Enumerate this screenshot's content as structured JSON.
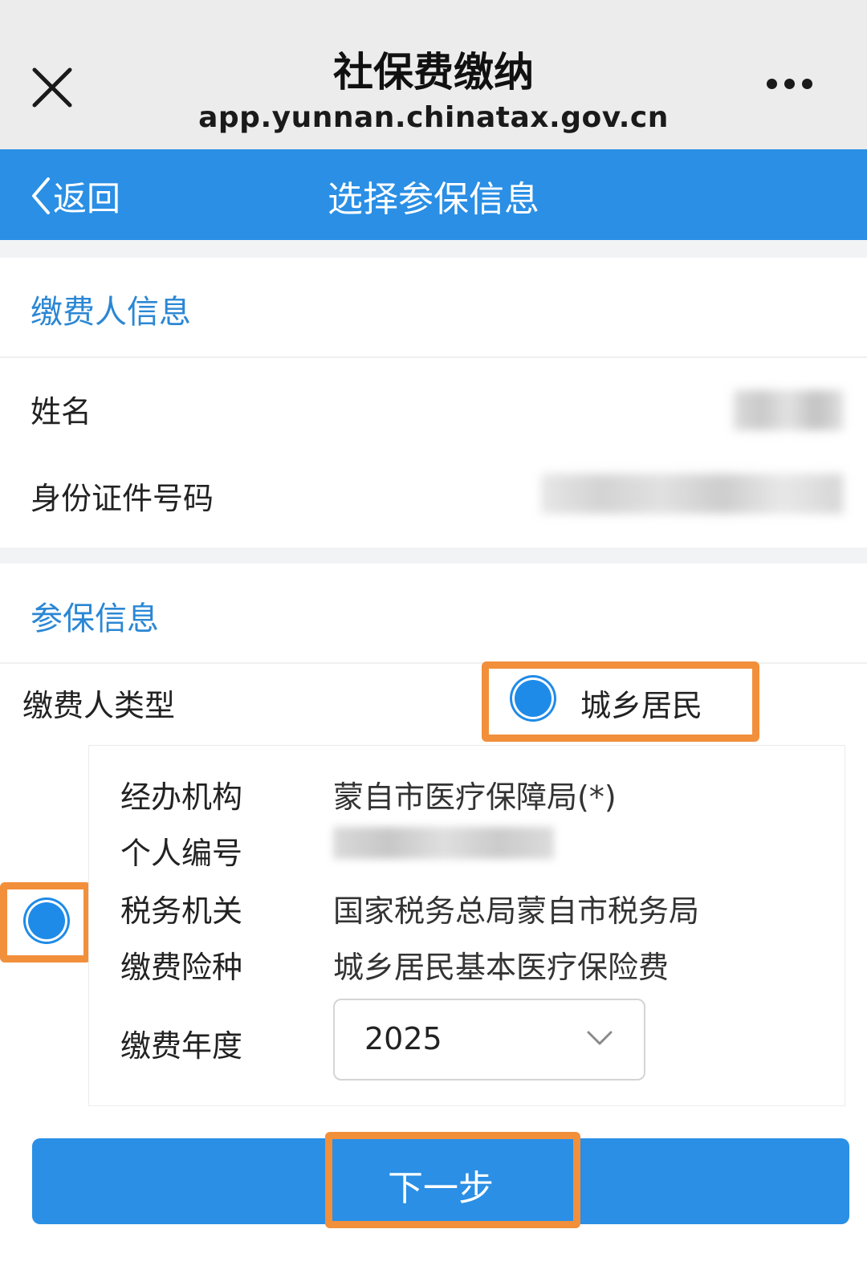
{
  "browser": {
    "title": "社保费缴纳",
    "url": "app.yunnan.chinatax.gov.cn"
  },
  "header": {
    "back_label": "返回",
    "title": "选择参保信息"
  },
  "payer_info": {
    "heading": "缴费人信息",
    "name_label": "姓名",
    "id_label": "身份证件号码"
  },
  "insurance_info": {
    "heading": "参保信息",
    "payer_type_label": "缴费人类型",
    "payer_type_option": "城乡居民",
    "rows": {
      "agency_label": "经办机构",
      "agency_value": "蒙自市医疗保障局(*)",
      "personal_no_label": "个人编号",
      "tax_office_label": "税务机关",
      "tax_office_value": "国家税务总局蒙自市税务局",
      "insurance_type_label": "缴费险种",
      "insurance_type_value": "城乡居民基本医疗保险费",
      "year_label": "缴费年度",
      "year_value": "2025"
    }
  },
  "next_button": "下一步",
  "colors": {
    "accent_blue": "#2a8fe5",
    "section_blue": "#2b87d4",
    "highlight_orange": "#f28f3b"
  }
}
